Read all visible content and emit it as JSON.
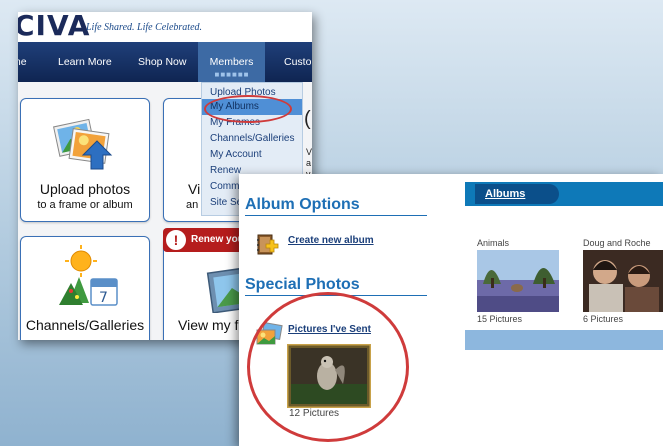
{
  "back": {
    "logo_text": "CIVA",
    "logo_tagline": "Life Shared.  Life Celebrated.",
    "nav": {
      "home": "me",
      "learn_more": "Learn More",
      "shop_now": "Shop Now",
      "members": "Members",
      "customer": "Custo"
    },
    "dropdown": {
      "items": [
        "Upload Photos",
        "My Albums",
        "My Frames",
        "Channels/Galleries",
        "My Account",
        "Renew",
        "Comm",
        "Site Se"
      ],
      "selected": "My Albums"
    },
    "tiles": {
      "upload_title": "Upload photos",
      "upload_sub": "to a frame or album",
      "view_title": "Vi",
      "view_sub": "an",
      "channels_title": "Channels/Galleries",
      "viewmy_title": "View my fr",
      "renew_banner": "Renew you"
    },
    "edge_text": "(",
    "edge_small": [
      "V",
      "a",
      "v",
      "c"
    ]
  },
  "front": {
    "album_options_heading": "Album Options",
    "create_album_link": "Create new album",
    "special_photos_heading": "Special Photos",
    "pictures_sent_link": "Pictures I've Sent",
    "pictures_sent_count": "12 Pictures",
    "albums_tab": "Albums",
    "albums": [
      {
        "name": "Animals",
        "count": "15 Pictures"
      },
      {
        "name": "Doug and Roche",
        "count": "6 Pictures"
      }
    ]
  },
  "colors": {
    "navy": "#0f2552",
    "members_tab": "#3d6aa4",
    "dropdown_highlight": "#4f8fd6",
    "heading_blue": "#1e6fb5",
    "albums_bar": "#0e79b8",
    "callout_red": "#cf3b3b"
  }
}
